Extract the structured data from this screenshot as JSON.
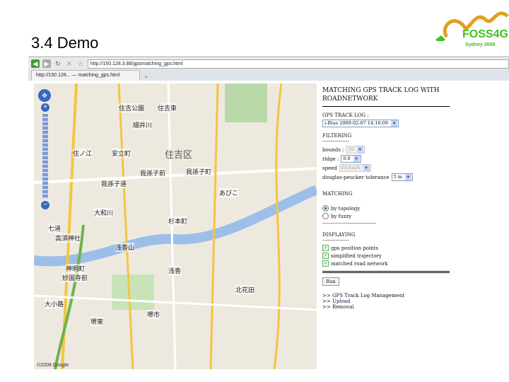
{
  "slide": {
    "title": "3.4 Demo",
    "logo_text": "FOSS4G",
    "logo_sub": "Sydney 2009"
  },
  "browser": {
    "url": "http://150.128.3.88/gpsmatching_gps.html",
    "tab_label": "http://150.128... — matching_gps.html",
    "new_tab": "+"
  },
  "map": {
    "labels": [
      "住吉公園",
      "住吉東",
      "細井川",
      "安立町",
      "住ノ江",
      "住吉区",
      "我孫子前",
      "我孫子道",
      "我孫子町",
      "あびこ",
      "大和川",
      "杉本町",
      "浅香山",
      "浅香",
      "七道",
      "高須神社",
      "堺市",
      "北花田",
      "妙国寺前",
      "大小路",
      "神明町",
      "堺東"
    ],
    "zoom_in": "+",
    "zoom_out": "−",
    "copyright": "©2009 Google"
  },
  "panel": {
    "title": "MATCHING GPS TRACK LOG WITH ROADNETWORK",
    "gps_label": "GPS TRACK LOG :",
    "gps_value": "i-Blue 2009-02-07 14:16:09",
    "filtering_title": "FILTERING",
    "dashes": "----------------",
    "bounds_label": "bounds :",
    "bounds_value": "20",
    "ridge_label": "ridge :",
    "ridge_value": "0.0",
    "speed_label": "speed",
    "speed_value": "60 km/h",
    "buffer_label": "douglas-peucker tolerance",
    "buffer_value": "5 m",
    "matching_title": "MATCHING",
    "radio1": "by topology",
    "radio2": "by fuzzy",
    "long_dashes": "--------------------------------",
    "display_title": "DISPLAYING",
    "check1": "gps position points",
    "check2": "simplified trajectory",
    "check3": "matched road network",
    "button": "Run",
    "mgmt": ">> GPS Track Log Management",
    "upload": ">> Upload",
    "removal": ">> Removal"
  }
}
